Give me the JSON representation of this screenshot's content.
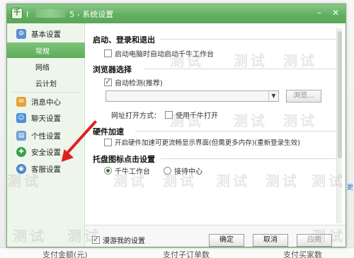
{
  "window": {
    "title_prefix": "I",
    "title_suffix": "5 - 系统设置",
    "minimize_glyph": "–",
    "close_glyph": "✕"
  },
  "sidebar": {
    "items": [
      {
        "label": "基本设置",
        "icon": "gear-icon",
        "color": "#5b8fd0"
      },
      {
        "label": "常规",
        "selected": true
      },
      {
        "label": "网络"
      },
      {
        "label": "云计划"
      },
      {
        "label": "消息中心",
        "icon": "envelope-icon",
        "color": "#e2a23a"
      },
      {
        "label": "聊天设置",
        "icon": "chat-icon",
        "color": "#4a90d9"
      },
      {
        "label": "个性设置",
        "icon": "palette-icon",
        "color": "#6fa0d8"
      },
      {
        "label": "安全设置",
        "icon": "shield-icon",
        "color": "#3aa04a"
      },
      {
        "label": "客服设置",
        "icon": "headset-icon",
        "color": "#4c86c9"
      }
    ]
  },
  "content": {
    "startup": {
      "title": "启动、登录和退出",
      "option_autostart": "启动电脑时自动启动千牛工作台",
      "autostart_checked": false
    },
    "browser": {
      "title": "浏览器选择",
      "option_auto_detect": "自动检测(推荐)",
      "auto_detect_checked": true,
      "browse_label": "浏览...",
      "open_mode_label": "网址打开方式：",
      "option_use_qianniu": "使用千牛打开",
      "use_qianniu_checked": false
    },
    "hardware": {
      "title": "硬件加速",
      "option_accel": "开启硬件加速可更流畅显示界面(但需更多内存)(重新登录生效)",
      "accel_checked": false
    },
    "tray": {
      "title": "托盘图标点击设置",
      "option_workbench": "千牛工作台",
      "option_receive_center": "接待中心",
      "selected": "workbench"
    }
  },
  "footer": {
    "roaming_label": "漫游我的设置",
    "roaming_checked": true,
    "ok_label": "确定",
    "cancel_label": "取消",
    "apply_label": "应用"
  },
  "background": {
    "bottom_tabs": [
      "支付金额(元)",
      "支付子订单数",
      "支付买家数"
    ],
    "right_edge_text": "更"
  },
  "watermark": {
    "text": "测试"
  },
  "colors": {
    "accent_green": "#5aae57",
    "annotation_red": "#e02020"
  }
}
